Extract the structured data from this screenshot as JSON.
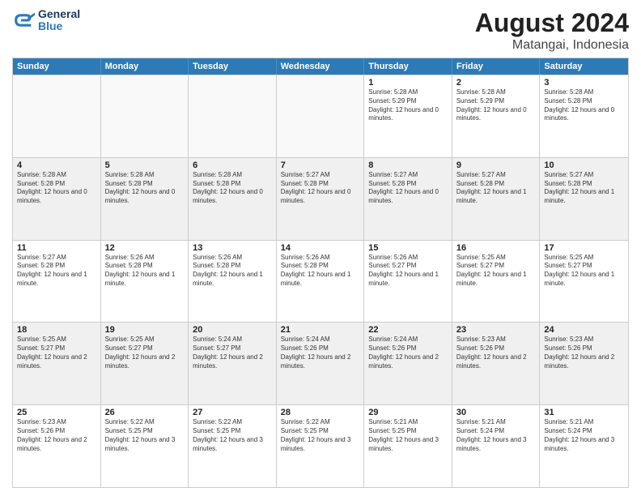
{
  "logo": {
    "line1": "General",
    "line2": "Blue"
  },
  "title": "August 2024",
  "subtitle": "Matangai, Indonesia",
  "days_of_week": [
    "Sunday",
    "Monday",
    "Tuesday",
    "Wednesday",
    "Thursday",
    "Friday",
    "Saturday"
  ],
  "weeks": [
    [
      {
        "day": "",
        "empty": true
      },
      {
        "day": "",
        "empty": true
      },
      {
        "day": "",
        "empty": true
      },
      {
        "day": "",
        "empty": true
      },
      {
        "day": "1",
        "sunrise": "5:28 AM",
        "sunset": "5:29 PM",
        "daylight": "12 hours and 0 minutes."
      },
      {
        "day": "2",
        "sunrise": "5:28 AM",
        "sunset": "5:29 PM",
        "daylight": "12 hours and 0 minutes."
      },
      {
        "day": "3",
        "sunrise": "5:28 AM",
        "sunset": "5:28 PM",
        "daylight": "12 hours and 0 minutes."
      }
    ],
    [
      {
        "day": "4",
        "sunrise": "5:28 AM",
        "sunset": "5:28 PM",
        "daylight": "12 hours and 0 minutes."
      },
      {
        "day": "5",
        "sunrise": "5:28 AM",
        "sunset": "5:28 PM",
        "daylight": "12 hours and 0 minutes."
      },
      {
        "day": "6",
        "sunrise": "5:28 AM",
        "sunset": "5:28 PM",
        "daylight": "12 hours and 0 minutes."
      },
      {
        "day": "7",
        "sunrise": "5:27 AM",
        "sunset": "5:28 PM",
        "daylight": "12 hours and 0 minutes."
      },
      {
        "day": "8",
        "sunrise": "5:27 AM",
        "sunset": "5:28 PM",
        "daylight": "12 hours and 0 minutes."
      },
      {
        "day": "9",
        "sunrise": "5:27 AM",
        "sunset": "5:28 PM",
        "daylight": "12 hours and 1 minute."
      },
      {
        "day": "10",
        "sunrise": "5:27 AM",
        "sunset": "5:28 PM",
        "daylight": "12 hours and 1 minute."
      }
    ],
    [
      {
        "day": "11",
        "sunrise": "5:27 AM",
        "sunset": "5:28 PM",
        "daylight": "12 hours and 1 minute."
      },
      {
        "day": "12",
        "sunrise": "5:26 AM",
        "sunset": "5:28 PM",
        "daylight": "12 hours and 1 minute."
      },
      {
        "day": "13",
        "sunrise": "5:26 AM",
        "sunset": "5:28 PM",
        "daylight": "12 hours and 1 minute."
      },
      {
        "day": "14",
        "sunrise": "5:26 AM",
        "sunset": "5:28 PM",
        "daylight": "12 hours and 1 minute."
      },
      {
        "day": "15",
        "sunrise": "5:26 AM",
        "sunset": "5:27 PM",
        "daylight": "12 hours and 1 minute."
      },
      {
        "day": "16",
        "sunrise": "5:25 AM",
        "sunset": "5:27 PM",
        "daylight": "12 hours and 1 minute."
      },
      {
        "day": "17",
        "sunrise": "5:25 AM",
        "sunset": "5:27 PM",
        "daylight": "12 hours and 1 minute."
      }
    ],
    [
      {
        "day": "18",
        "sunrise": "5:25 AM",
        "sunset": "5:27 PM",
        "daylight": "12 hours and 2 minutes."
      },
      {
        "day": "19",
        "sunrise": "5:25 AM",
        "sunset": "5:27 PM",
        "daylight": "12 hours and 2 minutes."
      },
      {
        "day": "20",
        "sunrise": "5:24 AM",
        "sunset": "5:27 PM",
        "daylight": "12 hours and 2 minutes."
      },
      {
        "day": "21",
        "sunrise": "5:24 AM",
        "sunset": "5:26 PM",
        "daylight": "12 hours and 2 minutes."
      },
      {
        "day": "22",
        "sunrise": "5:24 AM",
        "sunset": "5:26 PM",
        "daylight": "12 hours and 2 minutes."
      },
      {
        "day": "23",
        "sunrise": "5:23 AM",
        "sunset": "5:26 PM",
        "daylight": "12 hours and 2 minutes."
      },
      {
        "day": "24",
        "sunrise": "5:23 AM",
        "sunset": "5:26 PM",
        "daylight": "12 hours and 2 minutes."
      }
    ],
    [
      {
        "day": "25",
        "sunrise": "5:23 AM",
        "sunset": "5:26 PM",
        "daylight": "12 hours and 2 minutes."
      },
      {
        "day": "26",
        "sunrise": "5:22 AM",
        "sunset": "5:25 PM",
        "daylight": "12 hours and 3 minutes."
      },
      {
        "day": "27",
        "sunrise": "5:22 AM",
        "sunset": "5:25 PM",
        "daylight": "12 hours and 3 minutes."
      },
      {
        "day": "28",
        "sunrise": "5:22 AM",
        "sunset": "5:25 PM",
        "daylight": "12 hours and 3 minutes."
      },
      {
        "day": "29",
        "sunrise": "5:21 AM",
        "sunset": "5:25 PM",
        "daylight": "12 hours and 3 minutes."
      },
      {
        "day": "30",
        "sunrise": "5:21 AM",
        "sunset": "5:24 PM",
        "daylight": "12 hours and 3 minutes."
      },
      {
        "day": "31",
        "sunrise": "5:21 AM",
        "sunset": "5:24 PM",
        "daylight": "12 hours and 3 minutes."
      }
    ]
  ]
}
